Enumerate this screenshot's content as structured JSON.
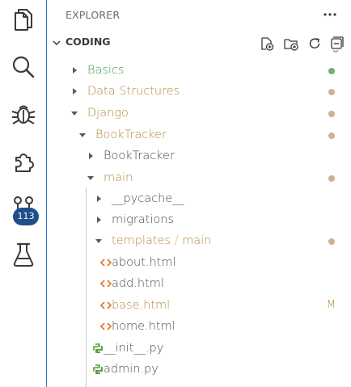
{
  "activity_bar": {
    "items": [
      {
        "name": "explorer-icon"
      },
      {
        "name": "search-icon"
      },
      {
        "name": "debug-icon"
      },
      {
        "name": "extensions-icon"
      },
      {
        "name": "source-control-icon"
      },
      {
        "name": "testing-icon"
      }
    ],
    "source_control_badge": "113"
  },
  "explorer": {
    "title": "EXPLORER",
    "section": "CODING",
    "header_actions": [
      "new-file-icon",
      "new-folder-icon",
      "refresh-icon",
      "collapse-all-icon"
    ]
  },
  "tree": [
    {
      "label": "Basics",
      "type": "folder",
      "state": "collapsed",
      "color": "#3f9b4a",
      "status_dot": "#6db36f"
    },
    {
      "label": "Data Structures",
      "type": "folder",
      "state": "collapsed",
      "color": "#b58a3e",
      "status_dot": "#c9b48e"
    },
    {
      "label": "Django",
      "type": "folder",
      "state": "expanded",
      "color": "#b58a3e",
      "status_dot": "#c9b48e"
    },
    {
      "label": "BookTracker",
      "type": "folder",
      "state": "expanded",
      "color": "#b58a3e",
      "status_dot": "#c9b48e"
    },
    {
      "label": "BookTracker",
      "type": "folder",
      "state": "collapsed",
      "color": "#4a4a4a"
    },
    {
      "label": "main",
      "type": "folder",
      "state": "expanded",
      "color": "#b58a3e",
      "status_dot": "#c9b48e"
    },
    {
      "label": "__pycache__",
      "type": "folder",
      "state": "collapsed",
      "color": "#4a4a4a"
    },
    {
      "label": "migrations",
      "type": "folder",
      "state": "collapsed",
      "color": "#4a4a4a"
    },
    {
      "label": "templates",
      "label_suffix": "main",
      "type": "folder",
      "state": "expanded",
      "color": "#b58a3e",
      "status_dot": "#c9b48e"
    },
    {
      "label": "about.html",
      "type": "html",
      "color": "#4a4a4a"
    },
    {
      "label": "add.html",
      "type": "html",
      "color": "#4a4a4a"
    },
    {
      "label": "base.html",
      "type": "html",
      "color": "#b58a3e",
      "status": "M"
    },
    {
      "label": "home.html",
      "type": "html",
      "color": "#4a4a4a"
    },
    {
      "label": "__init__.py",
      "type": "python",
      "color": "#4a4a4a"
    },
    {
      "label": "admin.py",
      "type": "python",
      "color": "#4a4a4a"
    }
  ],
  "colors": {
    "accent": "#2a78c6",
    "badge": "#1f4f8a",
    "modified": "#b58a3e",
    "untracked": "#3f9b4a",
    "html_icon": "#e37933",
    "python_icon": "#7cb860"
  }
}
